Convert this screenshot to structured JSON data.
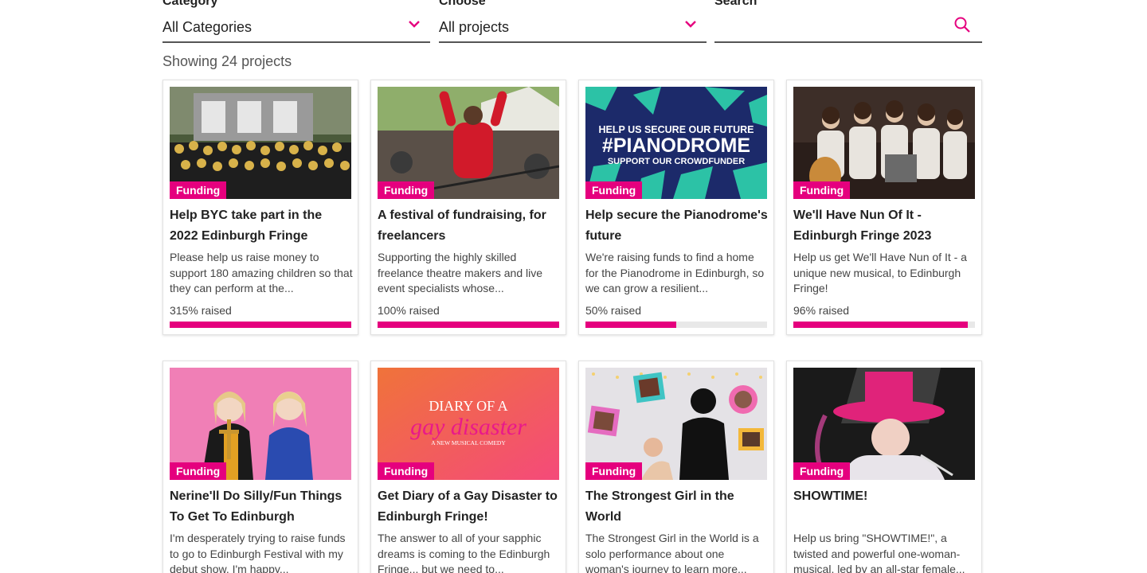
{
  "filters": {
    "category": {
      "label": "Category",
      "value": "All Categories"
    },
    "choose": {
      "label": "Choose",
      "value": "All projects"
    },
    "search": {
      "label": "Search",
      "value": ""
    }
  },
  "results": {
    "count_text": "Showing 24 projects"
  },
  "colors": {
    "accent": "#e5007e",
    "bar_track": "#e8e8e8"
  },
  "cards": [
    {
      "badge": "Funding",
      "title": "Help BYC take part in the 2022 Edinburgh Fringe",
      "description": "Please help us raise money to support 180 amazing children so that they can perform at the...",
      "raised": "315% raised",
      "progress": 1.0
    },
    {
      "badge": "Funding",
      "title": "A festival of fundraising, for freelancers",
      "description": "Supporting the highly skilled freelance theatre makers and live event specialists whose...",
      "raised": "100% raised",
      "progress": 1.0
    },
    {
      "badge": "Funding",
      "title": "Help secure the Pianodrome's future",
      "description": "We're raising funds to find a home for the Pianodrome in Edinburgh, so we can grow a resilient...",
      "raised": "50% raised",
      "progress": 0.5,
      "image_text": {
        "line1": "HELP US SECURE OUR FUTURE",
        "line2": "#PIANODROME",
        "line3": "SUPPORT OUR CROWDFUNDER"
      }
    },
    {
      "badge": "Funding",
      "title": "We'll Have Nun Of It - Edinburgh Fringe 2023",
      "description": "Help us get We'll Have Nun of It - a unique new musical, to Edinburgh Fringe!",
      "raised": "96% raised",
      "progress": 0.96
    },
    {
      "badge": "Funding",
      "title": "Nerine'll Do Silly/Fun Things To Get To Edinburgh",
      "description": "I'm desperately trying to raise funds to go to Edinburgh Festival with my debut show. I'm happy...",
      "raised": "",
      "progress": null
    },
    {
      "badge": "Funding",
      "title": "Get Diary of a Gay Disaster to Edinburgh Fringe!",
      "description": "The answer to all of your sapphic dreams is coming to the Edinburgh Fringe... but we need to...",
      "raised": "",
      "progress": null,
      "image_text": {
        "line1": "DIARY OF A",
        "line2": "gay disaster",
        "line3": "A NEW MUSICAL COMEDY"
      }
    },
    {
      "badge": "Funding",
      "title": "The Strongest Girl in the World",
      "description": "The Strongest Girl in the World is a solo performance about one woman's journey to learn more...",
      "raised": "",
      "progress": null
    },
    {
      "badge": "Funding",
      "title": "SHOWTIME!",
      "description": "Help us bring \"SHOWTIME!\", a twisted and powerful one-woman-musical, led by an all-star female...",
      "raised": "",
      "progress": null
    }
  ]
}
